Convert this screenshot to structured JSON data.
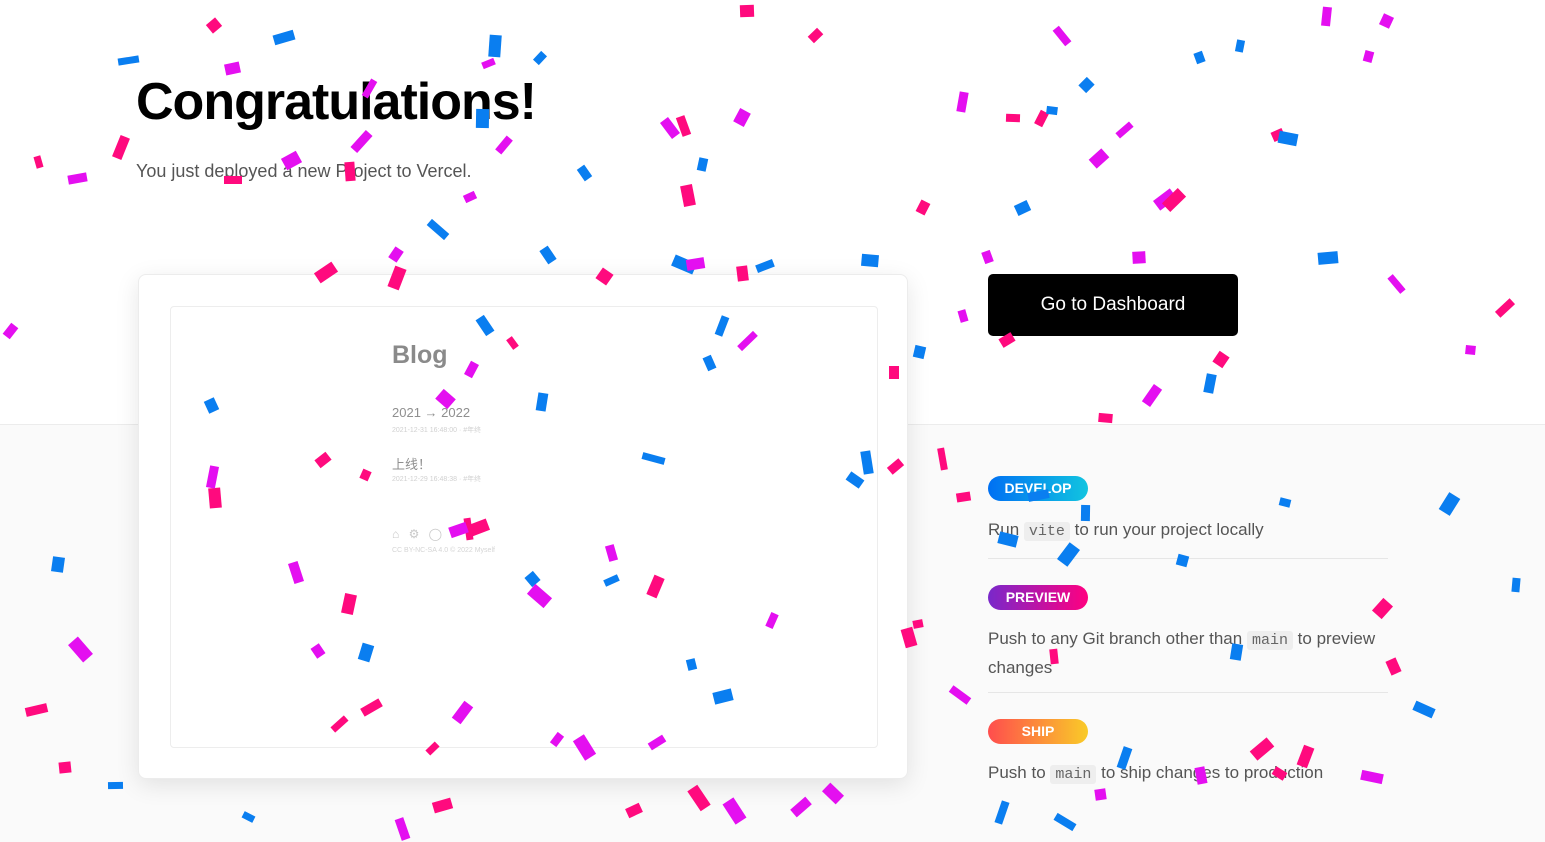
{
  "hero": {
    "title": "Congratulations!",
    "subtitle": "You just deployed a new Project to Vercel."
  },
  "preview": {
    "blog_title": "Blog",
    "posts": [
      {
        "title": "2021 → 2022",
        "meta": "2021-12-31 16:48:00 · #年终"
      },
      {
        "title": "上线！",
        "meta": "2021-12-29 16:48:38 · #年终"
      }
    ],
    "footer_icons": "⌂ ⚙ ◯",
    "footer_copy": "CC BY-NC-SA 4.0 © 2022 Myself"
  },
  "actions": {
    "dashboard_label": "Go to Dashboard"
  },
  "steps": [
    {
      "badge": "DEVELOP",
      "pre": "Run ",
      "code": "vite",
      "post": " to run your project locally"
    },
    {
      "badge": "PREVIEW",
      "pre": "Push to any Git branch other than ",
      "code": "main",
      "post": " to preview changes"
    },
    {
      "badge": "SHIP",
      "pre": "Push to ",
      "code": "main",
      "post": " to ship changes to production"
    }
  ],
  "confetti": {
    "colors": [
      "#ff0a7e",
      "#0a7ef0",
      "#e40ff0"
    ],
    "count": 150
  }
}
